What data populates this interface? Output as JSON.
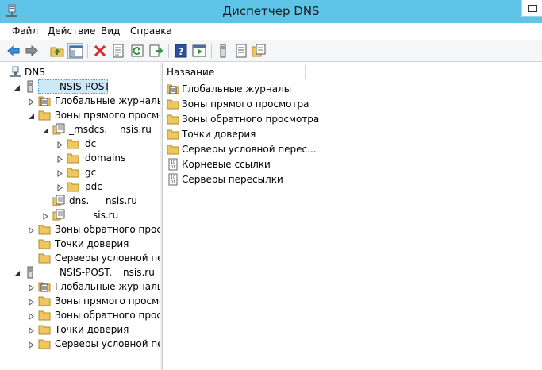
{
  "window": {
    "title": "Диспетчер DNS"
  },
  "menu": [
    "Файл",
    "Действие",
    "Вид",
    "Справка"
  ],
  "toolbar": {
    "buttons": [
      "back-arrow-icon",
      "forward-arrow-icon",
      "up-folder-icon",
      "show-hide-tree-icon",
      "delete-icon",
      "properties-icon",
      "refresh-icon",
      "export-list-icon",
      "help-icon",
      "console-view-icon",
      "server-icon",
      "list-icon",
      "zone-icon"
    ]
  },
  "tree": {
    "root": "DNS",
    "server1": "NSIS-POST",
    "global_logs": "Глобальные журналы",
    "forward_zones": "Зоны прямого просмотр",
    "msdcs_prefix": "_msdcs.",
    "msdcs_suffix": "nsis.ru",
    "dc": "dc",
    "domains": "domains",
    "gc": "gc",
    "pdc": "pdc",
    "dns_prefix": "dns.",
    "dns_suffix": "nsis.ru",
    "zone_suffix": "sis.ru",
    "reverse_zones": "Зоны обратного просмо",
    "trust_points": "Точки доверия",
    "cond_forwarders": "Серверы условной пер",
    "server2_prefix": "NSIS-POST.",
    "server2_suffix": "nsis.ru",
    "global_logs2": "Глобальные журналы",
    "forward_zones2": "Зоны прямого просмот",
    "reverse_zones2": "Зоны обратного просмо",
    "trust_points2": "Точки доверия",
    "cond_forwarders2": "Серверы условной пере"
  },
  "list": {
    "column": "Название",
    "items": [
      {
        "label": "Глобальные журналы",
        "icon": "log-icon"
      },
      {
        "label": "Зоны прямого просмотра",
        "icon": "folder-icon"
      },
      {
        "label": "Зоны обратного просмотра",
        "icon": "folder-icon"
      },
      {
        "label": "Точки доверия",
        "icon": "folder-icon"
      },
      {
        "label": "Серверы условной перес...",
        "icon": "folder-icon"
      },
      {
        "label": "Корневые ссылки",
        "icon": "binary-doc-icon"
      },
      {
        "label": "Серверы пересылки",
        "icon": "binary-doc-icon"
      }
    ]
  },
  "colors": {
    "titlebar": "#5fc5e8",
    "folder": "#f0c75e",
    "selection": "#cde8f7"
  }
}
